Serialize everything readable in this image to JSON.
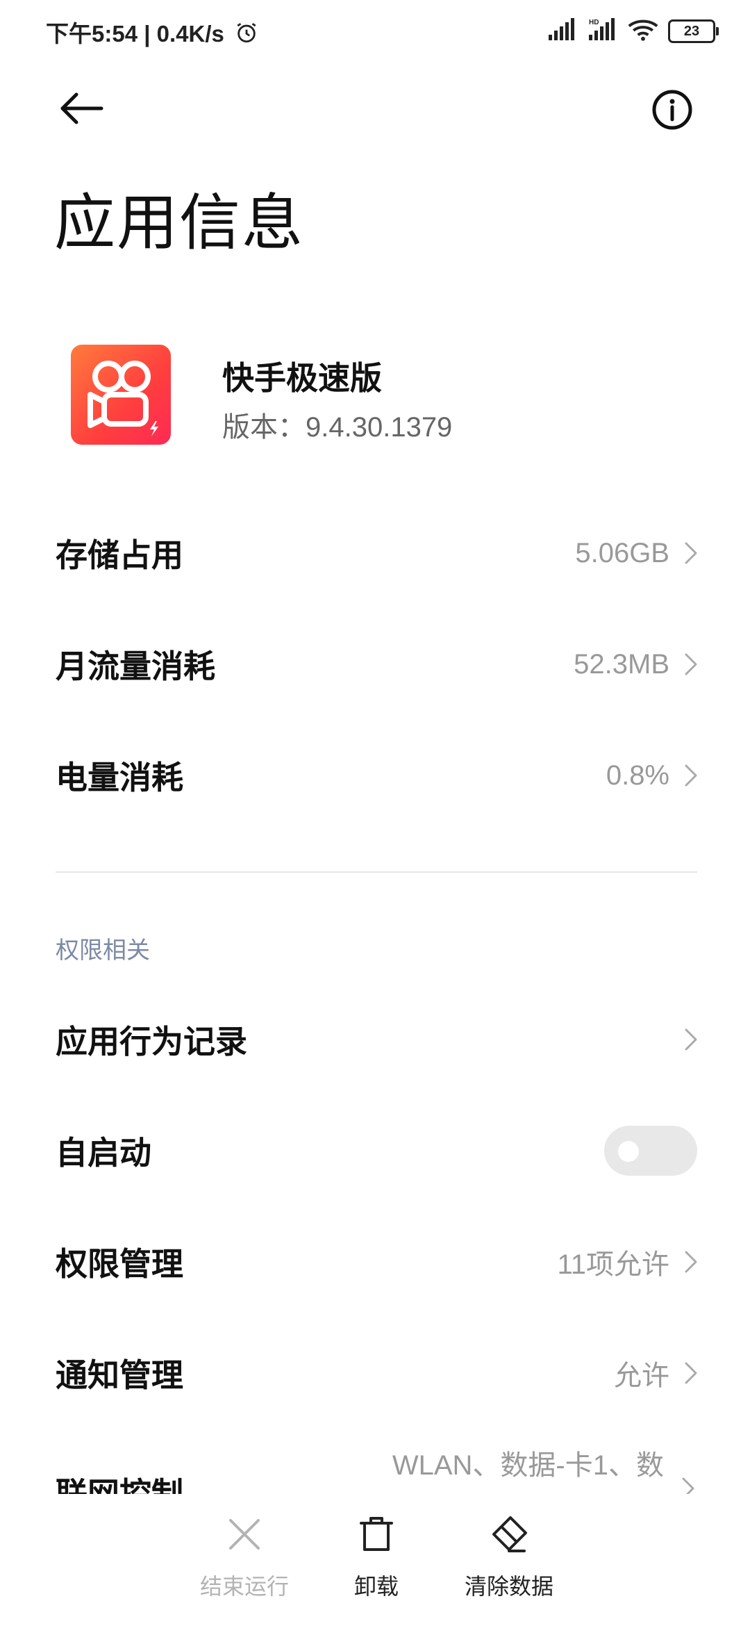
{
  "status_bar": {
    "time": "下午5:54 | 0.4K/s",
    "battery": "23"
  },
  "header": {
    "title": "应用信息"
  },
  "app": {
    "name": "快手极速版",
    "version": "版本：9.4.30.1379"
  },
  "info_rows": [
    {
      "label": "存储占用",
      "value": "5.06GB"
    },
    {
      "label": "月流量消耗",
      "value": "52.3MB"
    },
    {
      "label": "电量消耗",
      "value": "0.8%"
    }
  ],
  "permissions": {
    "section_title": "权限相关",
    "rows": [
      {
        "label": "应用行为记录",
        "value": ""
      },
      {
        "label": "自启动",
        "value": ""
      },
      {
        "label": "权限管理",
        "value": "11项允许"
      },
      {
        "label": "通知管理",
        "value": "允许"
      },
      {
        "label": "联网控制",
        "value": "WLAN、数据-卡1、数"
      }
    ],
    "autostart_enabled": false
  },
  "bottom_bar": {
    "force_stop": "结束运行",
    "uninstall": "卸载",
    "clear_data": "清除数据"
  },
  "colors": {
    "accent_section": "#7d8aa5",
    "app_icon_gradient": [
      "#ff7a3d",
      "#ff2a55"
    ]
  }
}
